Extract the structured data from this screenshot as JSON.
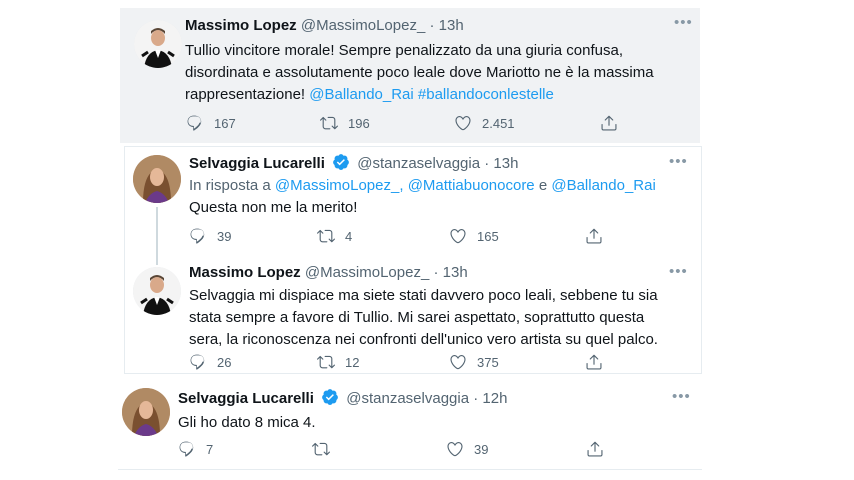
{
  "tweets": [
    {
      "name": "Massimo Lopez",
      "handle": "@MassimoLopez_",
      "time": "· 13h",
      "more": "•••",
      "text_lines": [
        "Tullio vincitore morale! Sempre penalizzato da una giuria confusa,",
        "disordinata e assolutamente poco leale dove Mariotto ne è la massima",
        "rappresentazione!"
      ],
      "mentions": [
        "@Ballando_Rai",
        "#ballandoconlestelle"
      ],
      "stats": {
        "replies": "167",
        "retweets": "196",
        "likes": "2.451"
      }
    },
    {
      "name": "Selvaggia Lucarelli",
      "handle": "@stanzaselvaggia",
      "time": "· 13h",
      "more": "•••",
      "reply_prefix": "In risposta a",
      "reply_to": [
        "@MassimoLopez_,",
        "@Mattiabuonocore",
        "e",
        "@Ballando_Rai"
      ],
      "text": "Questa non me la merito!",
      "stats": {
        "replies": "39",
        "retweets": "4",
        "likes": "165"
      }
    },
    {
      "name": "Massimo Lopez",
      "handle": "@MassimoLopez_",
      "time": "· 13h",
      "more": "•••",
      "text_lines": [
        "Selvaggia mi dispiace ma siete stati davvero poco leali, sebbene tu sia",
        "stata sempre a favore di Tullio. Mi sarei aspettato, soprattutto questa",
        "sera, la riconoscenza nei confronti dell'unico vero artista su quel palco."
      ],
      "stats": {
        "replies": "26",
        "retweets": "12",
        "likes": "375"
      }
    },
    {
      "name": "Selvaggia Lucarelli",
      "handle": "@stanzaselvaggia",
      "time": "· 12h",
      "more": "•••",
      "text": "Gli ho dato 8 mica 4.",
      "stats": {
        "replies": "7",
        "retweets": "",
        "likes": "39"
      }
    }
  ],
  "colors": {
    "link": "#1d9bf0",
    "muted": "#536471",
    "verified": "#1d9bf0"
  },
  "icons": [
    "reply-icon",
    "retweet-icon",
    "like-icon",
    "share-icon",
    "verified-badge-icon",
    "more-icon"
  ]
}
